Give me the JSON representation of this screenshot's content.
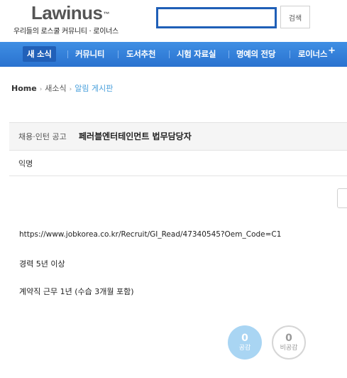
{
  "header": {
    "logo": "Lawinus",
    "logo_tm": "™",
    "tagline": "우리들의 로스쿨 커뮤니티 · 로이너스",
    "search_button": "검색",
    "search_value": ""
  },
  "nav": {
    "items": [
      {
        "label": "새 소식"
      },
      {
        "label": "커뮤니티"
      },
      {
        "label": "도서추천"
      },
      {
        "label": "시험 자료실"
      },
      {
        "label": "명예의 전당"
      },
      {
        "label": "로이너스"
      }
    ],
    "plus": "+"
  },
  "breadcrumb": {
    "home": "Home",
    "level1": "새소식",
    "current": "알림 게시판",
    "separator": "›"
  },
  "post": {
    "category": "채용·인턴 공고",
    "title": "페러블엔터테인먼트 법무담당자",
    "author": "익명",
    "body": {
      "url": "https://www.jobkorea.co.kr/Recruit/GI_Read/47340545?Oem_Code=C1",
      "line1": "경력 5년 이상",
      "line2": "계약직 근무 1년 (수습 3개월 포함)"
    }
  },
  "votes": {
    "like_count": "0",
    "like_label": "공감",
    "dislike_count": "0",
    "dislike_label": "비공감"
  },
  "colors": {
    "nav_blue": "#2a72cf",
    "search_border": "#1f5fb7",
    "breadcrumb_current": "#4aa0dc",
    "like_bg": "#a9d5f3"
  }
}
